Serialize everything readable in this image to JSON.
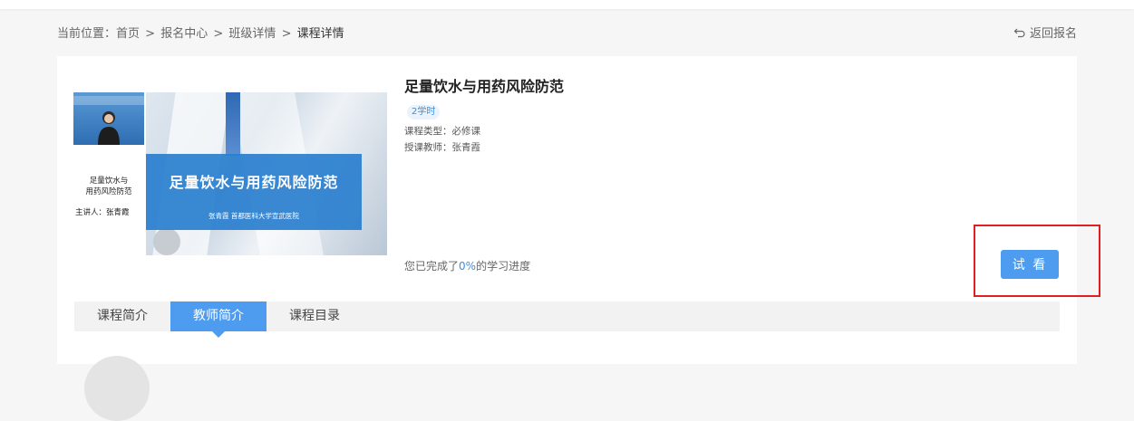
{
  "breadcrumb": {
    "prefix": "当前位置：",
    "items": [
      "首页",
      "报名中心",
      "班级详情",
      "课程详情"
    ],
    "separator": ">"
  },
  "back_label": "返回报名",
  "course": {
    "title": "足量饮水与用药风险防范",
    "hours_badge": "2学时",
    "type_line": "课程类型：必修课",
    "teacher_line": "授课教师：张青霞",
    "progress_prefix": "您已完成了",
    "progress_value": "0%",
    "progress_suffix": "的学习进度",
    "progress_fraction": 0
  },
  "thumbnail": {
    "left_title": "足量饮水与\n用药风险防范",
    "speaker": "主讲人：张青霞",
    "slide_title": "足量饮水与用药风险防范",
    "slide_subtitle": "张青霞  首都医科大学宣武医院"
  },
  "try_button": "试 看",
  "tabs": [
    {
      "label": "课程简介",
      "active": false
    },
    {
      "label": "教师简介",
      "active": true
    },
    {
      "label": "课程目录",
      "active": false
    }
  ],
  "colors": {
    "accent": "#4d9cf0",
    "highlight": "#e02020"
  }
}
